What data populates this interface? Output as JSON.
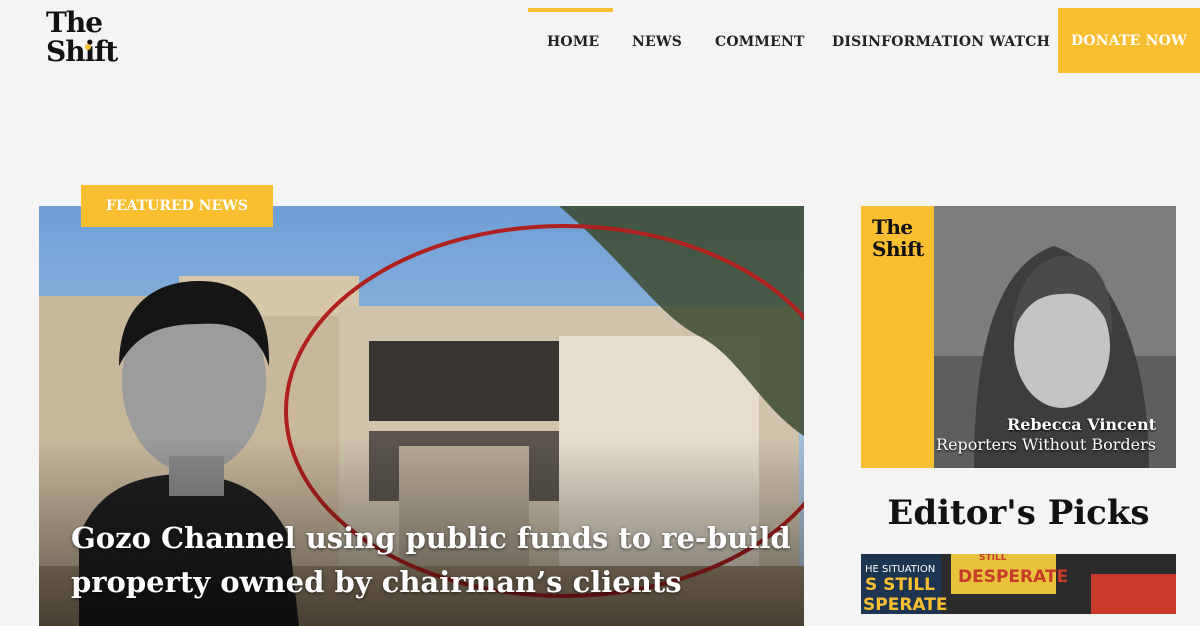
{
  "brand": {
    "line1": "The",
    "line2": "Shift",
    "accent": "#f9bf30"
  },
  "nav": {
    "items": [
      {
        "label": "HOME",
        "active": true
      },
      {
        "label": "NEWS",
        "active": false
      },
      {
        "label": "COMMENT",
        "active": false
      },
      {
        "label": "DISINFORMATION WATCH",
        "active": false
      }
    ],
    "donate_label": "DONATE NOW"
  },
  "featured": {
    "badge": "FEATURED NEWS",
    "headline": "Gozo Channel using public funds to re-build property owned by chairman’s clients"
  },
  "sidebar": {
    "ad": {
      "logo_line1": "The",
      "logo_line2": "Shift",
      "name": "Rebecca Vincent",
      "org": "Reporters Without Borders"
    },
    "picks_title": "Editor's Picks",
    "picks_thumb_text": {
      "top": "HE SITUATION",
      "mid": "S STILL",
      "bottom": "SPERATE",
      "sign": "DESPERATE",
      "sign_top": "STILL"
    }
  }
}
